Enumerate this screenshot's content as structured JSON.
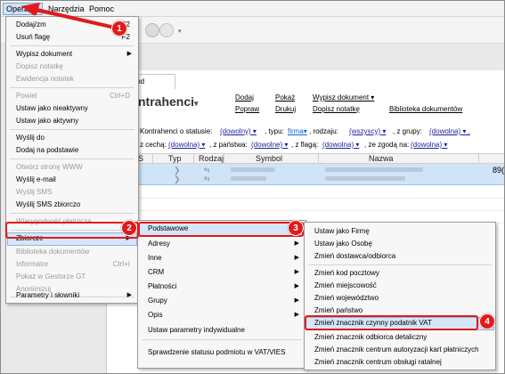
{
  "menubar": {
    "items": [
      "Operacje",
      "Narzędzia",
      "Pomoc"
    ]
  },
  "document": {
    "tab_label": "trahend",
    "heading": "ntrahenci",
    "actions": {
      "row1": [
        "Dodaj",
        "Pokaż",
        "Wypisz dokument"
      ],
      "row2": [
        "Popraw",
        "Drukuj",
        "Dopisz notatkę",
        "Biblioteka dokumentów"
      ]
    },
    "filters": {
      "status_label": "Kontrahenci o statusie:",
      "status_value": "(dowolny)",
      "typ_label": ", typu:",
      "typ_value": "firma",
      "rodzaj_label": ", rodzaju:",
      "rodzaj_value": "(wszyscy)",
      "grupa_label": ", z grupy:",
      "grupa_value": "(dowolna)",
      "cecha_label": "z cechą:",
      "cecha_value": "(dowolna)",
      "panstwo_label": ", z państwa:",
      "panstwo_value": "(dowolne)",
      "flaga_label": ", z flagą:",
      "flaga_value": "(dowolna)",
      "zgoda_label": ", ze zgodą na:",
      "zgoda_value": "(dowolna)"
    },
    "grid": {
      "columns": [
        "S",
        "Typ",
        "Rodzaj",
        "Symbol",
        "Nazwa"
      ],
      "row_tail": "89("
    }
  },
  "menu_operacje": {
    "items": [
      {
        "label": "Dodaj/zm",
        "shortcut": "F2",
        "disabled": false
      },
      {
        "label": "Usuń flagę",
        "shortcut": "F2",
        "disabled": false
      },
      {
        "label": "Wypisz dokument",
        "submenu": true,
        "disabled": false
      },
      {
        "label": "Dopisz notatkę",
        "disabled": true
      },
      {
        "label": "Ewidencja notatek",
        "disabled": true
      },
      {
        "label": "Powiel",
        "shortcut": "Ctrl+D",
        "disabled": true
      },
      {
        "label": "Ustaw jako nieaktywny",
        "disabled": false
      },
      {
        "label": "Ustaw jako aktywny",
        "disabled": false
      },
      {
        "label": "Wyślij do",
        "disabled": false
      },
      {
        "label": "Dodaj na podstawie",
        "disabled": false
      },
      {
        "label": "Otwórz stronę WWW",
        "disabled": true
      },
      {
        "label": "Wyślij e-mail",
        "disabled": false
      },
      {
        "label": "Wyślij SMS",
        "disabled": true
      },
      {
        "label": "Wyślij SMS zbiorczo",
        "disabled": false
      },
      {
        "label": "Wiarygodność płatnicza",
        "disabled": true
      },
      {
        "label": "Zbiorcze",
        "submenu": true,
        "disabled": false,
        "highlighted": true
      },
      {
        "label": "Biblioteka dokumentów",
        "disabled": true
      },
      {
        "label": "Informator",
        "shortcut": "Ctrl+I",
        "disabled": true
      },
      {
        "label": "Pokaż w Gestorze GT",
        "disabled": true
      },
      {
        "label": "Anonimizuj",
        "disabled": true
      },
      {
        "label": "Parametry i słowniki",
        "submenu": true,
        "disabled": false
      }
    ]
  },
  "menu_zbiorcze": {
    "items": [
      {
        "label": "Podstawowe",
        "submenu": true,
        "highlighted": true
      },
      {
        "label": "Adresy",
        "submenu": true
      },
      {
        "label": "Inne",
        "submenu": true
      },
      {
        "label": "CRM",
        "submenu": true
      },
      {
        "label": "Płatności",
        "submenu": true
      },
      {
        "label": "Grupy",
        "submenu": true
      },
      {
        "label": "Opis",
        "submenu": true
      },
      {
        "label": "Ustaw parametry indywidualne"
      },
      {
        "label": "Sprawdzenie statusu podmiotu w VAT/VIES"
      }
    ]
  },
  "menu_podstawowe": {
    "items": [
      {
        "label": "Ustaw jako Firmę"
      },
      {
        "label": "Ustaw jako Osobę"
      },
      {
        "label": "Zmień dostawca/odbiorca"
      },
      {
        "label": "Zmień kod pocztowy"
      },
      {
        "label": "Zmień miejscowość"
      },
      {
        "label": "Zmień województwo"
      },
      {
        "label": "Zmień państwo"
      },
      {
        "label": "Zmień znacznik czynny podatnik VAT",
        "highlighted": true
      },
      {
        "label": "Zmień znacznik odbiorca detaliczny"
      },
      {
        "label": "Zmień znacznik centrum autoryzacji kart płatniczych"
      },
      {
        "label": "Zmień znacznik centrum obsługi ratalnej"
      }
    ]
  },
  "annotations": {
    "badges": [
      "1",
      "2",
      "3",
      "4"
    ],
    "color": "#e01b1b"
  }
}
